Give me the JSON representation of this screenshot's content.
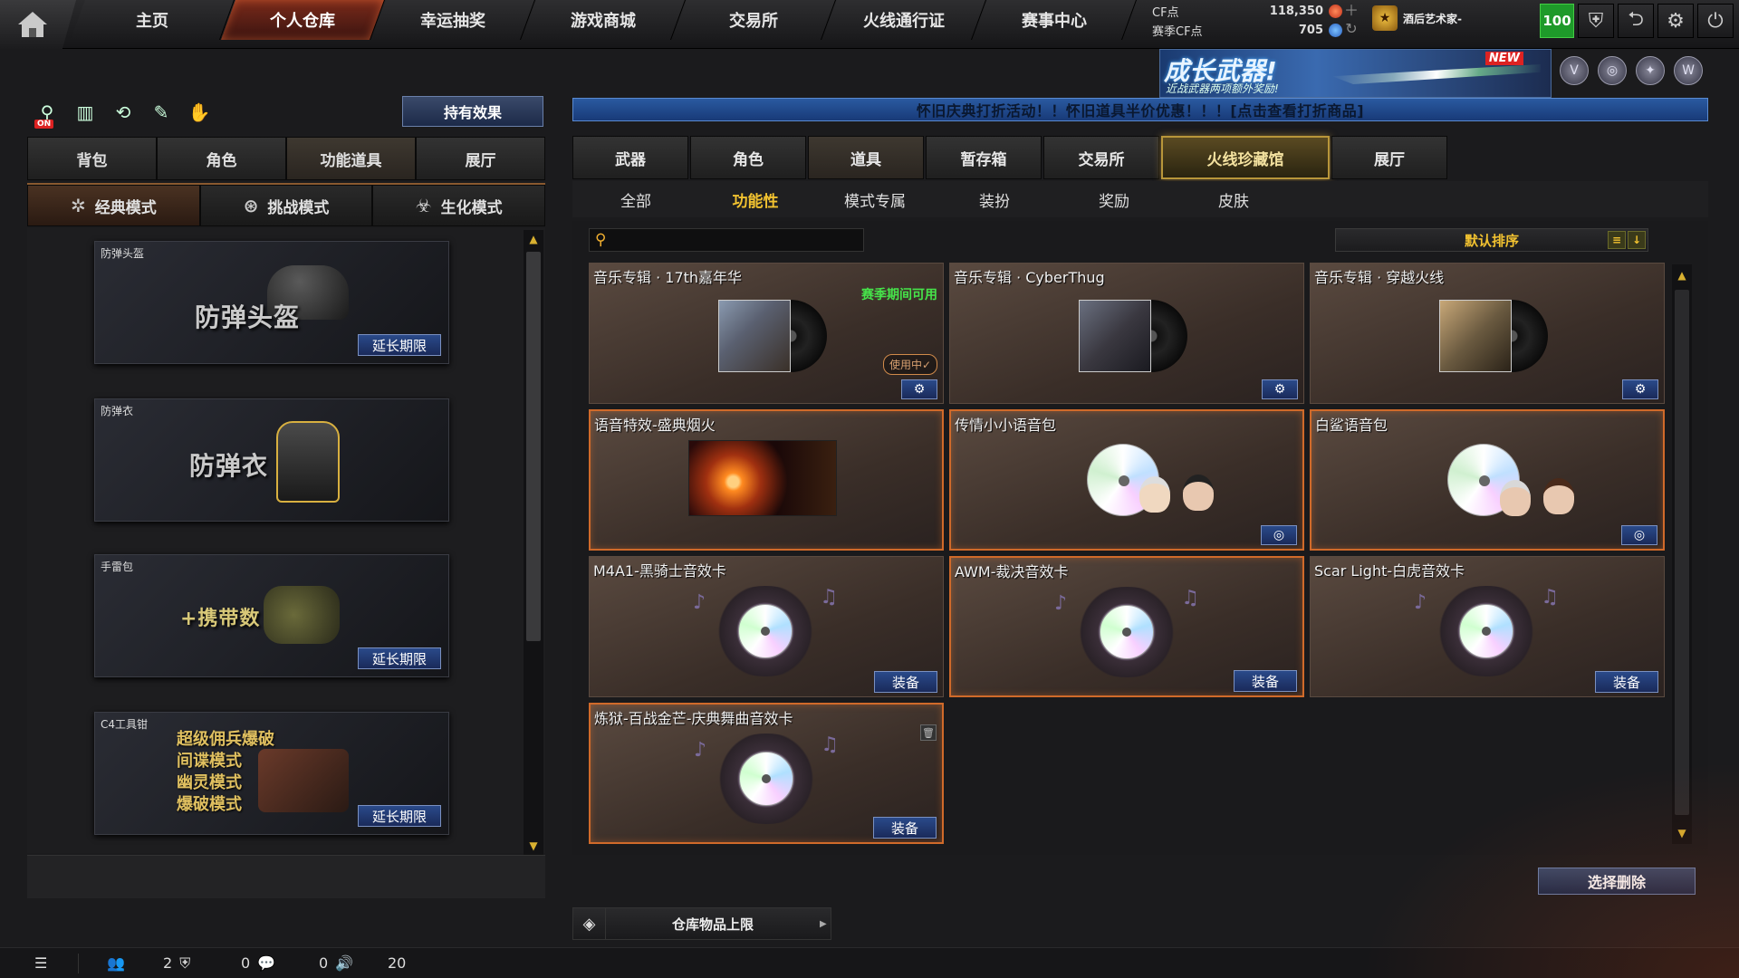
{
  "nav": {
    "tabs": [
      "主页",
      "个人仓库",
      "幸运抽奖",
      "游戏商城",
      "交易所",
      "火线通行证",
      "赛事中心"
    ],
    "active": "个人仓库"
  },
  "currency": {
    "cf_label": "CF点",
    "cf_value": "118,350",
    "season_label": "赛季CF点",
    "season_value": "705"
  },
  "profile": {
    "name": "酒后艺术家-",
    "level": "100"
  },
  "banner": {
    "title": "成长武器!",
    "subtitle": "近战武器两项额外奖励!",
    "badge": "NEW"
  },
  "left": {
    "effect_button": "持有效果",
    "tabs": [
      "背包",
      "角色",
      "功能道具",
      "展厅"
    ],
    "active_tab": "功能道具",
    "modes": [
      "经典模式",
      "挑战模式",
      "生化模式"
    ],
    "active_mode": "经典模式",
    "on_badge": "ON",
    "items": [
      {
        "name": "防弹头盔",
        "art": "防弹头盔",
        "extend": "延长期限"
      },
      {
        "name": "防弹衣",
        "art": "防弹衣",
        "extend": ""
      },
      {
        "name": "手雷包",
        "art": "+携带数",
        "extend": "延长期限"
      },
      {
        "name": "C4工具钳",
        "art_lines": [
          "超级佣兵爆破",
          "间谍模式",
          "幽灵模式",
          "爆破模式"
        ],
        "extend": "延长期限"
      }
    ]
  },
  "notice": "怀旧庆典打折活动！！怀旧道具半价优惠！！！[点击查看打折商品]",
  "right": {
    "tabs": [
      "武器",
      "角色",
      "道具",
      "暂存箱",
      "交易所",
      "火线珍藏馆",
      "展厅"
    ],
    "active_tab": "道具",
    "sub_tabs": [
      "全部",
      "功能性",
      "模式专属",
      "装扮",
      "奖励",
      "皮肤"
    ],
    "active_sub": "功能性",
    "search_placeholder": "",
    "sort": "默认排序",
    "cards": [
      {
        "name": "音乐专辑 · 17th嘉年华",
        "season": "赛季期间可用",
        "inuse": "使用中✓",
        "kind": "vinyl"
      },
      {
        "name": "音乐专辑 · CyberThug",
        "kind": "vinyl"
      },
      {
        "name": "音乐专辑 · 穿越火线",
        "kind": "vinyl"
      },
      {
        "name": "语音特效-盛典烟火",
        "kind": "fx"
      },
      {
        "name": "传情小小语音包",
        "kind": "voice"
      },
      {
        "name": "白鲨语音包",
        "kind": "voice"
      },
      {
        "name": "M4A1-黑骑士音效卡",
        "equip": "装备",
        "kind": "speaker"
      },
      {
        "name": "AWM-裁决音效卡",
        "equip": "装备",
        "kind": "speaker"
      },
      {
        "name": "Scar Light-白虎音效卡",
        "equip": "装备",
        "kind": "speaker"
      },
      {
        "name": "炼狱-百战金芒-庆典舞曲音效卡",
        "equip": "装备",
        "kind": "speaker"
      }
    ],
    "delete_button": "选择删除",
    "capacity_label": "仓库物品上限"
  },
  "status": {
    "users": "2",
    "shield": "0",
    "chat": "0",
    "volume": "20"
  }
}
